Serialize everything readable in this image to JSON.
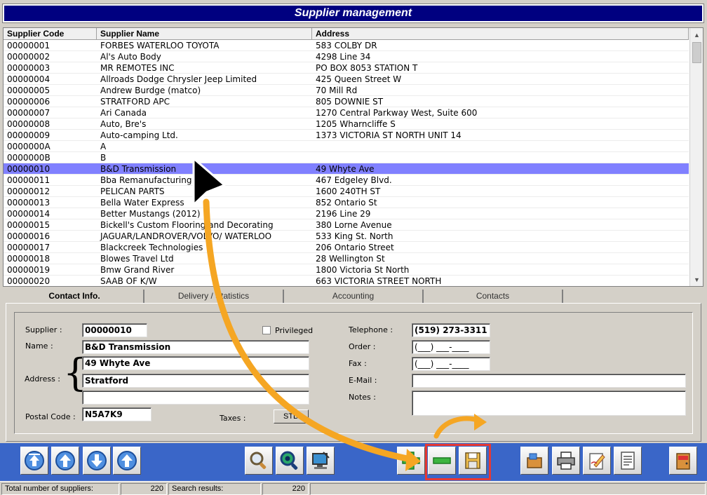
{
  "window": {
    "title": "Supplier management"
  },
  "grid": {
    "columns": [
      "Supplier Code",
      "Supplier Name",
      "Address"
    ],
    "rows": [
      [
        "00000001",
        "FORBES WATERLOO TOYOTA",
        "583 COLBY DR"
      ],
      [
        "00000002",
        "Al's Auto Body",
        "4298 Line 34"
      ],
      [
        "00000003",
        "MR REMOTES INC",
        "PO BOX 8053 STATION T"
      ],
      [
        "00000004",
        "Allroads Dodge Chrysler Jeep Limited",
        "425 Queen Street W"
      ],
      [
        "00000005",
        "Andrew Burdge (matco)",
        "70 Mill Rd"
      ],
      [
        "00000006",
        "STRATFORD APC",
        "805 DOWNIE ST"
      ],
      [
        "00000007",
        "Ari Canada",
        "1270 Central Parkway West, Suite 600"
      ],
      [
        "00000008",
        "Auto, Bre's",
        "1205 Wharncliffe S"
      ],
      [
        "00000009",
        "Auto-camping Ltd.",
        "1373 VICTORIA ST NORTH UNIT 14"
      ],
      [
        "0000000A",
        "A",
        ""
      ],
      [
        "0000000B",
        "B",
        ""
      ],
      [
        "00000010",
        "B&D Transmission",
        "49 Whyte Ave"
      ],
      [
        "00000011",
        "Bba Remanufacturing",
        "467 Edgeley Blvd."
      ],
      [
        "00000012",
        "PELICAN PARTS",
        "1600 240TH ST"
      ],
      [
        "00000013",
        "Bella Water Express",
        "852 Ontario St"
      ],
      [
        "00000014",
        "Better Mustangs (2012)",
        "2196 Line 29"
      ],
      [
        "00000015",
        "Bickell's Custom Flooring and Decorating",
        "380 Lorne Avenue"
      ],
      [
        "00000016",
        "JAGUAR/LANDROVER/VOLVO/ WATERLOO",
        "533 King St. North"
      ],
      [
        "00000017",
        "Blackcreek Technologies",
        "206 Ontario Street"
      ],
      [
        "00000018",
        "Blowes Travel Ltd",
        "28 Wellington St"
      ],
      [
        "00000019",
        "Bmw Grand River",
        "1800 Victoria St North"
      ],
      [
        "00000020",
        "SAAB OF K/W",
        "663 VICTORIA STREET NORTH"
      ]
    ],
    "selected_index": 11
  },
  "tabs": [
    "Contact Info.",
    "Delivery / Statistics",
    "Accounting",
    "Contacts"
  ],
  "form": {
    "supplier_label": "Supplier :",
    "supplier": "00000010",
    "privileged_label": "Privileged",
    "name_label": "Name :",
    "name": "B&D Transmission",
    "address_label": "Address :",
    "address1": "49 Whyte Ave",
    "address2": "Stratford",
    "address3": "",
    "postal_label": "Postal Code :",
    "postal": "N5A7K9",
    "taxes_label": "Taxes :",
    "taxes_button": "STD",
    "telephone_label": "Telephone :",
    "telephone": "(519) 273-3311",
    "order_label": "Order :",
    "order": "(___) ___-____",
    "fax_label": "Fax :",
    "fax": "(___) ___-____",
    "email_label": "E-Mail :",
    "email": "",
    "notes_label": "Notes :",
    "notes": ""
  },
  "status": {
    "total_label": "Total number of suppliers:",
    "total_value": "220",
    "search_label": "Search results:",
    "search_value": "220"
  },
  "colors": {
    "title_bg": "#000080",
    "selected_row": "#8080ff",
    "toolbar_bg": "#3a66c8",
    "annotation_arrow": "#f5a623",
    "highlight_box": "#e53935"
  }
}
